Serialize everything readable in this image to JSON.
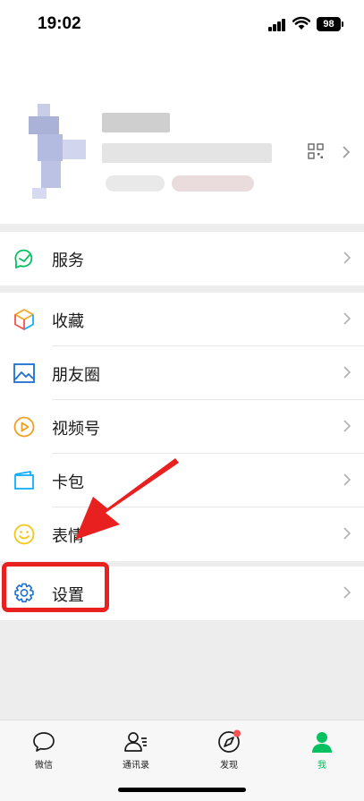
{
  "status_bar": {
    "time": "19:02",
    "battery": "98"
  },
  "profile": {
    "qr_icon": "qr-code-icon",
    "chevron_icon": "chevron-right-icon"
  },
  "menu": {
    "service": {
      "label": "服务",
      "icon": "service-icon"
    },
    "favorites": {
      "label": "收藏",
      "icon": "favorites-cube-icon"
    },
    "moments": {
      "label": "朋友圈",
      "icon": "moments-image-icon"
    },
    "channels": {
      "label": "视频号",
      "icon": "channels-play-icon"
    },
    "cards": {
      "label": "卡包",
      "icon": "card-wallet-icon"
    },
    "stickers": {
      "label": "表情",
      "icon": "smiley-icon"
    },
    "settings": {
      "label": "设置",
      "icon": "gear-icon"
    }
  },
  "tabbar": {
    "tabs": [
      {
        "label": "微信",
        "icon": "chat-bubble-icon",
        "active": false
      },
      {
        "label": "通讯录",
        "icon": "contacts-icon",
        "active": false
      },
      {
        "label": "发现",
        "icon": "compass-icon",
        "active": false,
        "badge": true
      },
      {
        "label": "我",
        "icon": "person-icon",
        "active": true
      }
    ]
  },
  "annotation": {
    "color": "#e8201f"
  },
  "colors": {
    "accent": "#07c160",
    "badge": "#fa5151"
  }
}
